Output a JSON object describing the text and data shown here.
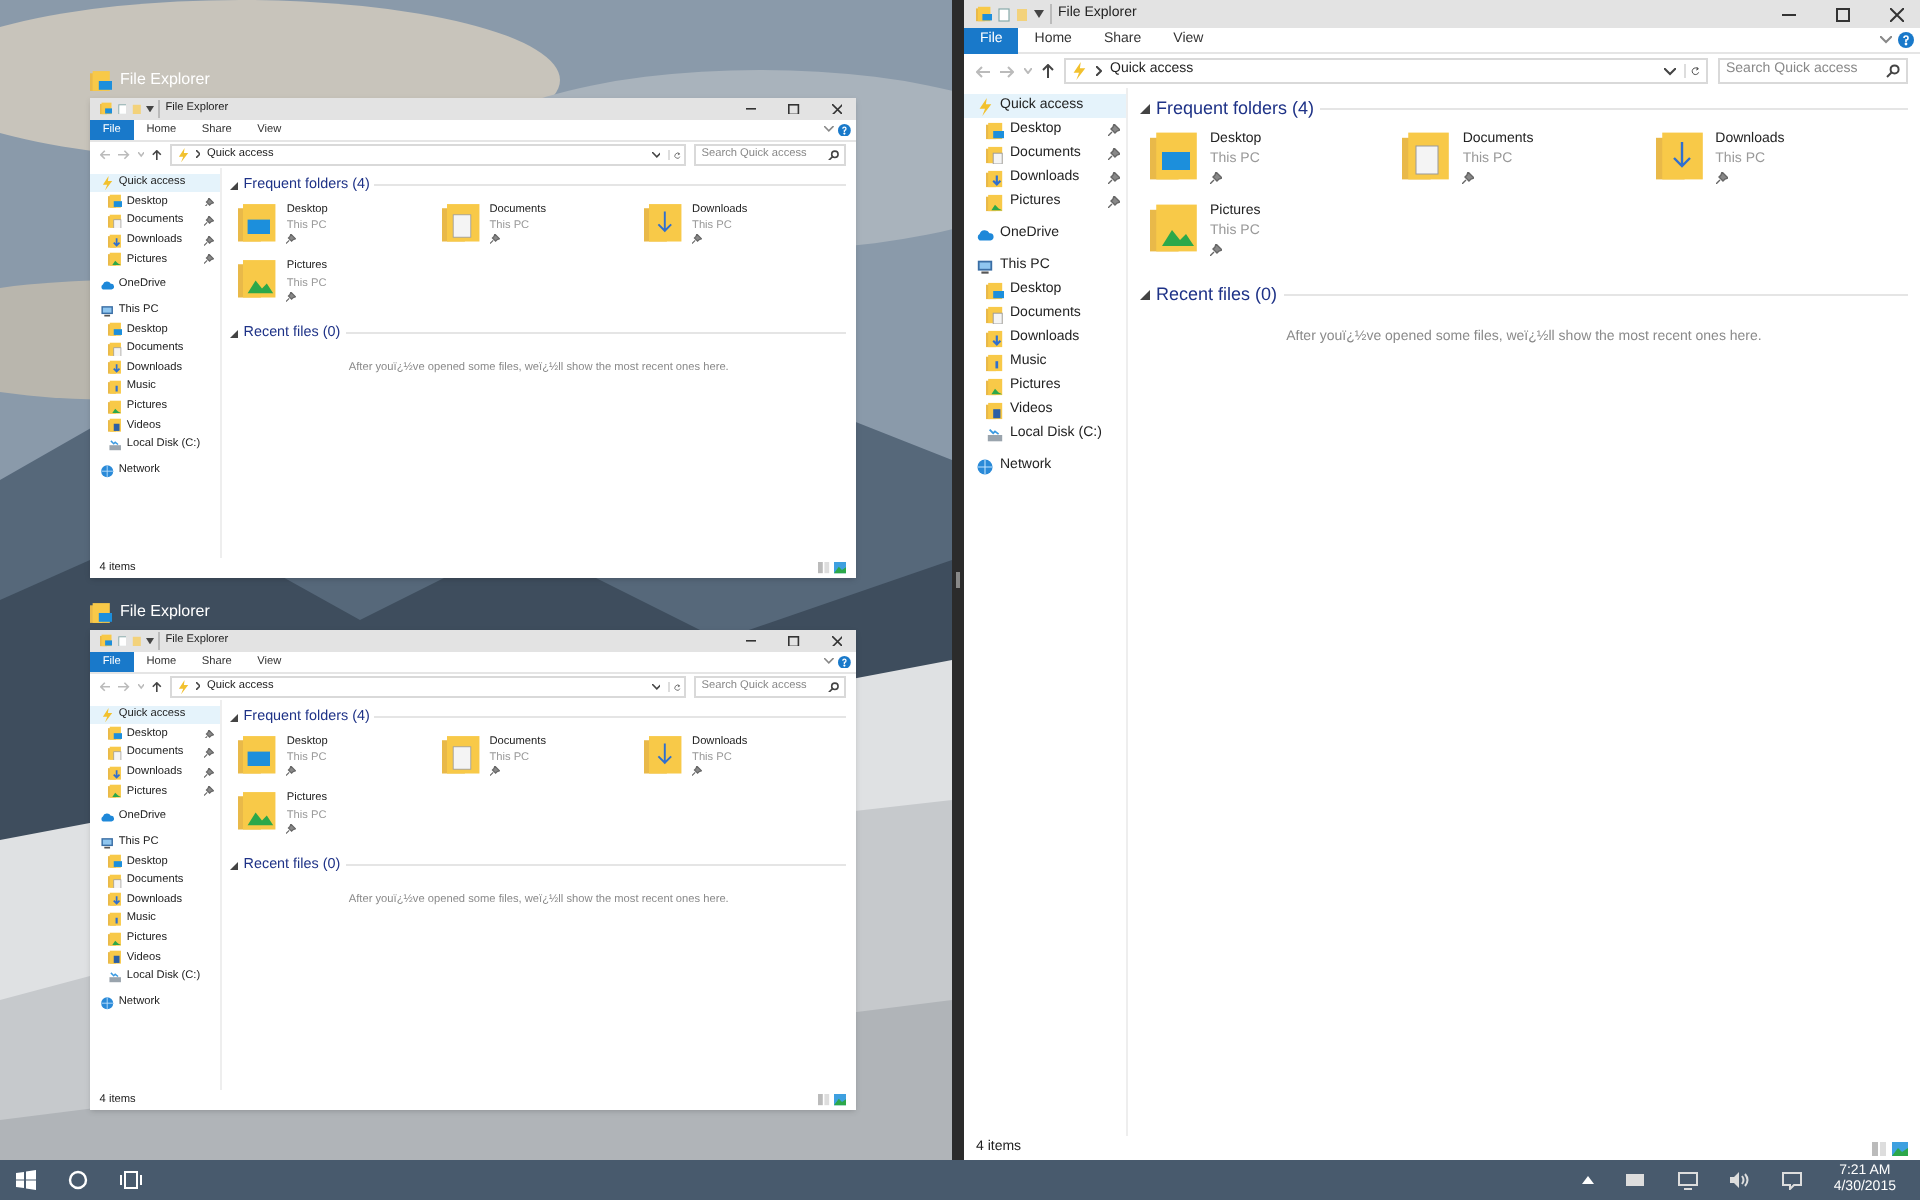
{
  "snap_assist": [
    {
      "caption": "File Explorer",
      "window": {
        "title": "File Explorer",
        "ribbon_tabs": [
          {
            "label": "File",
            "selected": true
          },
          {
            "label": "Home",
            "selected": false
          },
          {
            "label": "Share",
            "selected": false
          },
          {
            "label": "View",
            "selected": false
          }
        ],
        "address": "Quick access",
        "search": {
          "placeholder": "Search Quick access"
        },
        "navigation": [
          {
            "label": "Quick access",
            "kind": "star",
            "selected": true,
            "children": [
              {
                "label": "Desktop",
                "kind": "desktop",
                "pinned": true,
                "selected": false
              },
              {
                "label": "Documents",
                "kind": "documents",
                "pinned": true,
                "selected": false
              },
              {
                "label": "Downloads",
                "kind": "downloads",
                "pinned": true,
                "selected": false
              },
              {
                "label": "Pictures",
                "kind": "pictures",
                "pinned": true,
                "selected": false
              }
            ]
          },
          {
            "label": "OneDrive",
            "kind": "cloud",
            "selected": false
          },
          {
            "label": "This PC",
            "kind": "computer",
            "selected": false,
            "children": [
              {
                "label": "Desktop",
                "kind": "desktop",
                "pinned": false,
                "selected": false
              },
              {
                "label": "Documents",
                "kind": "documents",
                "pinned": false,
                "selected": false
              },
              {
                "label": "Downloads",
                "kind": "downloads",
                "pinned": false,
                "selected": false
              },
              {
                "label": "Music",
                "kind": "music",
                "pinned": false,
                "selected": false
              },
              {
                "label": "Pictures",
                "kind": "pictures",
                "pinned": false,
                "selected": false
              },
              {
                "label": "Videos",
                "kind": "videos",
                "pinned": false,
                "selected": false
              },
              {
                "label": "Local Disk (C:)",
                "kind": "disk",
                "pinned": false,
                "selected": false
              }
            ]
          },
          {
            "label": "Network",
            "kind": "network",
            "selected": false
          }
        ],
        "sections": [
          {
            "title": "Frequent folders (4)",
            "expanded": true,
            "folders": [
              {
                "name": "Desktop",
                "location": "This PC",
                "pinned": true,
                "kind": "desktop"
              },
              {
                "name": "Documents",
                "location": "This PC",
                "pinned": true,
                "kind": "documents"
              },
              {
                "name": "Downloads",
                "location": "This PC",
                "pinned": true,
                "kind": "downloads"
              },
              {
                "name": "Pictures",
                "location": "This PC",
                "pinned": true,
                "kind": "pictures"
              }
            ]
          },
          {
            "title": "Recent files (0)",
            "expanded": true,
            "message": "After youï¿½ve opened some files, weï¿½ll show the most recent ones here."
          }
        ],
        "status": "4 items"
      }
    },
    {
      "caption": "File Explorer",
      "window": {
        "title": "File Explorer",
        "ribbon_tabs": [
          {
            "label": "File",
            "selected": true
          },
          {
            "label": "Home",
            "selected": false
          },
          {
            "label": "Share",
            "selected": false
          },
          {
            "label": "View",
            "selected": false
          }
        ],
        "address": "Quick access",
        "search": {
          "placeholder": "Search Quick access"
        },
        "navigation": [
          {
            "label": "Quick access",
            "kind": "star",
            "selected": true,
            "children": [
              {
                "label": "Desktop",
                "kind": "desktop",
                "pinned": true,
                "selected": false
              },
              {
                "label": "Documents",
                "kind": "documents",
                "pinned": true,
                "selected": false
              },
              {
                "label": "Downloads",
                "kind": "downloads",
                "pinned": true,
                "selected": false
              },
              {
                "label": "Pictures",
                "kind": "pictures",
                "pinned": true,
                "selected": false
              }
            ]
          },
          {
            "label": "OneDrive",
            "kind": "cloud",
            "selected": false
          },
          {
            "label": "This PC",
            "kind": "computer",
            "selected": false,
            "children": [
              {
                "label": "Desktop",
                "kind": "desktop",
                "pinned": false,
                "selected": false
              },
              {
                "label": "Documents",
                "kind": "documents",
                "pinned": false,
                "selected": false
              },
              {
                "label": "Downloads",
                "kind": "downloads",
                "pinned": false,
                "selected": false
              },
              {
                "label": "Music",
                "kind": "music",
                "pinned": false,
                "selected": false
              },
              {
                "label": "Pictures",
                "kind": "pictures",
                "pinned": false,
                "selected": false
              },
              {
                "label": "Videos",
                "kind": "videos",
                "pinned": false,
                "selected": false
              },
              {
                "label": "Local Disk (C:)",
                "kind": "disk",
                "pinned": false,
                "selected": false
              }
            ]
          },
          {
            "label": "Network",
            "kind": "network",
            "selected": false
          }
        ],
        "sections": [
          {
            "title": "Frequent folders (4)",
            "expanded": true,
            "folders": [
              {
                "name": "Desktop",
                "location": "This PC",
                "pinned": true,
                "kind": "desktop"
              },
              {
                "name": "Documents",
                "location": "This PC",
                "pinned": true,
                "kind": "documents"
              },
              {
                "name": "Downloads",
                "location": "This PC",
                "pinned": true,
                "kind": "downloads"
              },
              {
                "name": "Pictures",
                "location": "This PC",
                "pinned": true,
                "kind": "pictures"
              }
            ]
          },
          {
            "title": "Recent files (0)",
            "expanded": true,
            "message": "After youï¿½ve opened some files, weï¿½ll show the most recent ones here."
          }
        ],
        "status": "4 items"
      }
    }
  ],
  "window": {
    "title": "File Explorer",
    "ribbon_tabs": [
      {
        "label": "File",
        "selected": true
      },
      {
        "label": "Home",
        "selected": false
      },
      {
        "label": "Share",
        "selected": false
      },
      {
        "label": "View",
        "selected": false
      }
    ],
    "address": "Quick access",
    "search": {
      "placeholder": "Search Quick access"
    },
    "navigation": [
      {
        "label": "Quick access",
        "kind": "star",
        "selected": true,
        "children": [
          {
            "label": "Desktop",
            "kind": "desktop",
            "pinned": true,
            "selected": false
          },
          {
            "label": "Documents",
            "kind": "documents",
            "pinned": true,
            "selected": false
          },
          {
            "label": "Downloads",
            "kind": "downloads",
            "pinned": true,
            "selected": false
          },
          {
            "label": "Pictures",
            "kind": "pictures",
            "pinned": true,
            "selected": false
          }
        ]
      },
      {
        "label": "OneDrive",
        "kind": "cloud",
        "selected": false
      },
      {
        "label": "This PC",
        "kind": "computer",
        "selected": false,
        "children": [
          {
            "label": "Desktop",
            "kind": "desktop",
            "pinned": false,
            "selected": false
          },
          {
            "label": "Documents",
            "kind": "documents",
            "pinned": false,
            "selected": false
          },
          {
            "label": "Downloads",
            "kind": "downloads",
            "pinned": false,
            "selected": false
          },
          {
            "label": "Music",
            "kind": "music",
            "pinned": false,
            "selected": false
          },
          {
            "label": "Pictures",
            "kind": "pictures",
            "pinned": false,
            "selected": false
          },
          {
            "label": "Videos",
            "kind": "videos",
            "pinned": false,
            "selected": false
          },
          {
            "label": "Local Disk (C:)",
            "kind": "disk",
            "pinned": false,
            "selected": false
          }
        ]
      },
      {
        "label": "Network",
        "kind": "network",
        "selected": false
      }
    ],
    "sections": [
      {
        "title": "Frequent folders (4)",
        "expanded": true,
        "folders": [
          {
            "name": "Desktop",
            "location": "This PC",
            "pinned": true,
            "kind": "desktop"
          },
          {
            "name": "Documents",
            "location": "This PC",
            "pinned": true,
            "kind": "documents"
          },
          {
            "name": "Downloads",
            "location": "This PC",
            "pinned": true,
            "kind": "downloads"
          },
          {
            "name": "Pictures",
            "location": "This PC",
            "pinned": true,
            "kind": "pictures"
          }
        ]
      },
      {
        "title": "Recent files (0)",
        "expanded": true,
        "message": "After youï¿½ve opened some files, weï¿½ll show the most recent ones here."
      }
    ],
    "status": "4 items"
  },
  "taskbar": {
    "time": "7:21 AM",
    "date": "4/30/2015"
  }
}
